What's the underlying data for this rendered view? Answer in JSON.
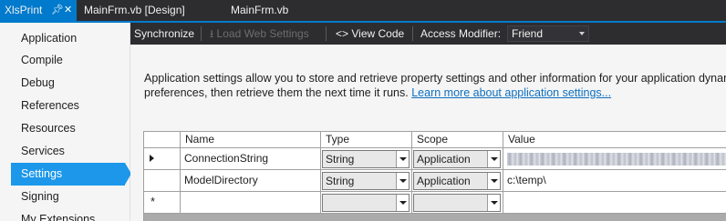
{
  "tabs": [
    {
      "label": "XlsPrint",
      "active": true
    },
    {
      "label": "MainFrm.vb [Design]",
      "active": false
    },
    {
      "label": "MainFrm.vb",
      "active": false
    }
  ],
  "tab_icons": {
    "pin": "pin-icon",
    "close": "close-icon"
  },
  "nav": {
    "items": [
      {
        "label": "Application"
      },
      {
        "label": "Compile"
      },
      {
        "label": "Debug"
      },
      {
        "label": "References"
      },
      {
        "label": "Resources"
      },
      {
        "label": "Services"
      },
      {
        "label": "Settings",
        "selected": true
      },
      {
        "label": "Signing"
      },
      {
        "label": "My Extensions"
      }
    ]
  },
  "toolbar": {
    "synchronize": "Synchronize",
    "load_web_settings": "Load Web Settings",
    "view_code": "View Code",
    "view_code_icon": "<>",
    "access_modifier_label": "Access Modifier:",
    "access_modifier_value": "Friend"
  },
  "description": {
    "line1": "Application settings allow you to store and retrieve property settings and other information for your application dynam",
    "line2": "preferences, then retrieve them the next time it runs.",
    "link": "Learn more about application settings..."
  },
  "grid": {
    "columns": [
      "Name",
      "Type",
      "Scope",
      "Value"
    ],
    "rows": [
      {
        "name": "ConnectionString",
        "type": "String",
        "scope": "Application",
        "value": ""
      },
      {
        "name": "ModelDirectory",
        "type": "String",
        "scope": "Application",
        "value": "c:\\temp\\"
      }
    ],
    "new_row_marker": "*"
  },
  "colors": {
    "accent": "#007acc",
    "nav_selected": "#1c97ea",
    "toolbar_bg": "#2d2d30",
    "link": "#0e70c0"
  }
}
